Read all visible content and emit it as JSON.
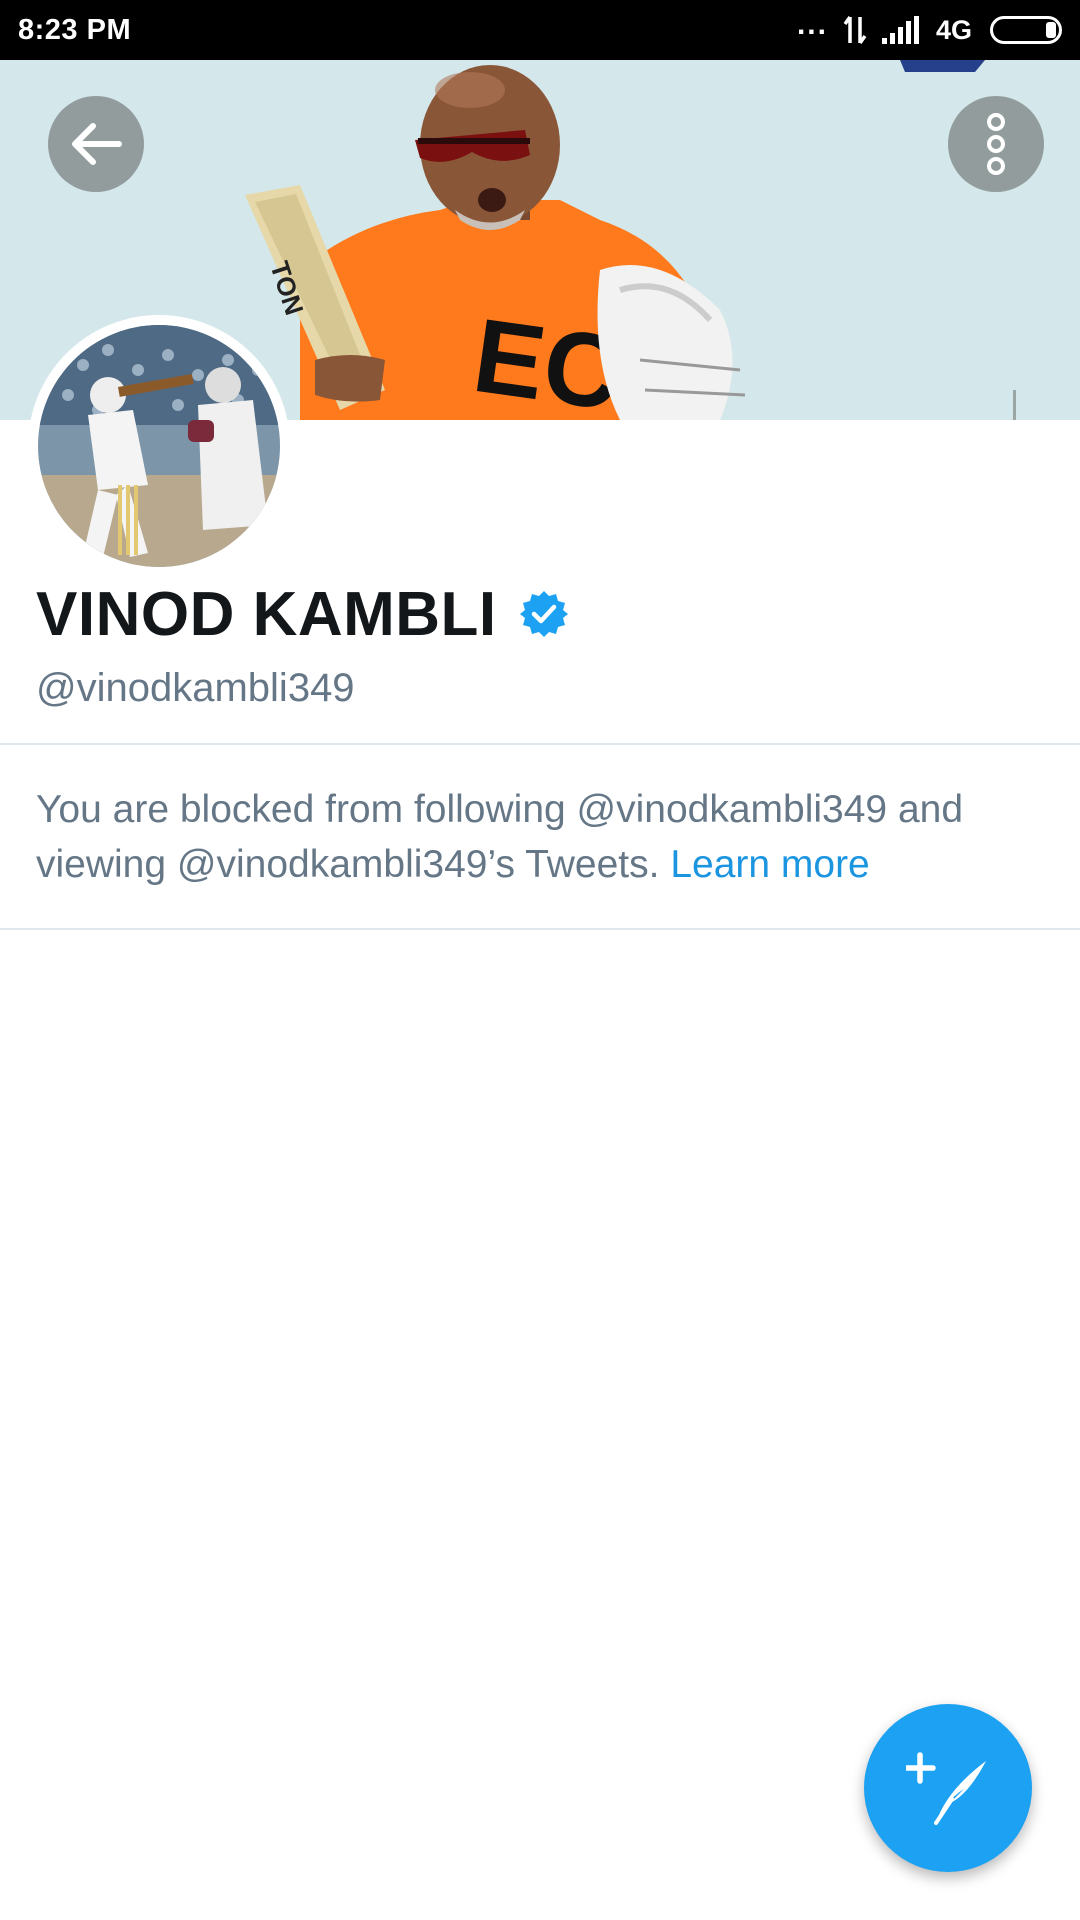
{
  "status_bar": {
    "time": "8:23 PM",
    "dots": "...",
    "network": "4G"
  },
  "banner": {
    "back_icon": "arrow-left-icon",
    "more_icon": "more-vertical-icon"
  },
  "profile": {
    "display_name": "VINOD KAMBLI",
    "handle": "@vinodkambli349",
    "verified": true,
    "verified_icon": "verified-badge-icon"
  },
  "blocked_notice": {
    "message": "You are blocked from following @vinodkambli349 and viewing @vinodkambli349’s Tweets.",
    "link_label": "Learn more"
  },
  "fab": {
    "icon": "compose-tweet-icon"
  },
  "colors": {
    "accent": "#1da1f2",
    "link": "#1b95e0",
    "secondary_text": "#657786",
    "primary_text": "#14171a",
    "divider": "#e1e8ed"
  }
}
